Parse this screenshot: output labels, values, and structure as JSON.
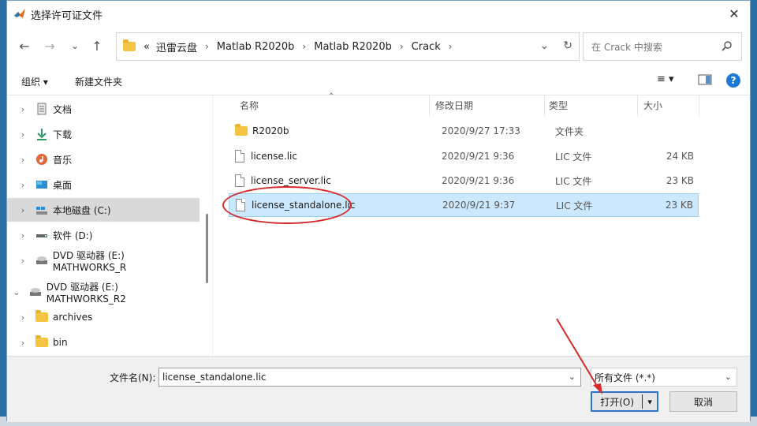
{
  "window": {
    "title": "选择许可证文件",
    "close_label": "✕"
  },
  "nav": {
    "back": "←",
    "forward": "→",
    "recent": "⌄",
    "up": "↑",
    "breadcrumbs": [
      "«",
      "迅雷云盘",
      "Matlab R2020b",
      "Matlab R2020b",
      "Crack"
    ],
    "search_placeholder": "在 Crack 中搜索"
  },
  "toolbar": {
    "organize": "组织 ▾",
    "new_folder": "新建文件夹",
    "view_menu": "≡ ▾",
    "help": "?"
  },
  "sidebar": {
    "items": [
      {
        "label": "文档",
        "icon": "document-icon",
        "chevron": "›"
      },
      {
        "label": "下载",
        "icon": "download-icon",
        "chevron": "›"
      },
      {
        "label": "音乐",
        "icon": "music-icon",
        "chevron": "›"
      },
      {
        "label": "桌面",
        "icon": "desktop-icon",
        "chevron": "›"
      },
      {
        "label": "本地磁盘 (C:)",
        "icon": "drive-icon",
        "chevron": "›"
      },
      {
        "label": "软件 (D:)",
        "icon": "drive-icon",
        "chevron": "›"
      },
      {
        "label": "DVD 驱动器 (E:) MATHWORKS_R",
        "icon": "dvd-icon",
        "chevron": "›"
      },
      {
        "label": "DVD 驱动器 (E:) MATHWORKS_R2",
        "icon": "dvd-icon",
        "chevron": "⌄"
      },
      {
        "label": "archives",
        "icon": "folder-icon",
        "chevron": "›"
      },
      {
        "label": "bin",
        "icon": "folder-icon",
        "chevron": "›"
      }
    ]
  },
  "files": {
    "headers": [
      "名称",
      "修改日期",
      "类型",
      "大小"
    ],
    "rows": [
      {
        "name": "R2020b",
        "date": "2020/9/27 17:33",
        "type": "文件夹",
        "size": "",
        "kind": "folder"
      },
      {
        "name": "license.lic",
        "date": "2020/9/21 9:36",
        "type": "LIC 文件",
        "size": "24 KB",
        "kind": "file"
      },
      {
        "name": "license_server.lic",
        "date": "2020/9/21 9:36",
        "type": "LIC 文件",
        "size": "23 KB",
        "kind": "file"
      },
      {
        "name": "license_standalone.lic",
        "date": "2020/9/21 9:37",
        "type": "LIC 文件",
        "size": "23 KB",
        "kind": "file",
        "selected": true
      }
    ]
  },
  "footer": {
    "filename_label": "文件名(N):",
    "filename_value": "license_standalone.lic",
    "filetype_value": "所有文件 (*.*)",
    "open_label": "打开(O)",
    "open_arrow": "▾",
    "cancel_label": "取消"
  },
  "colors": {
    "selection": "#cce8ff",
    "highlight_annotation": "#d42a2a",
    "primary_border": "#2a73c8"
  }
}
